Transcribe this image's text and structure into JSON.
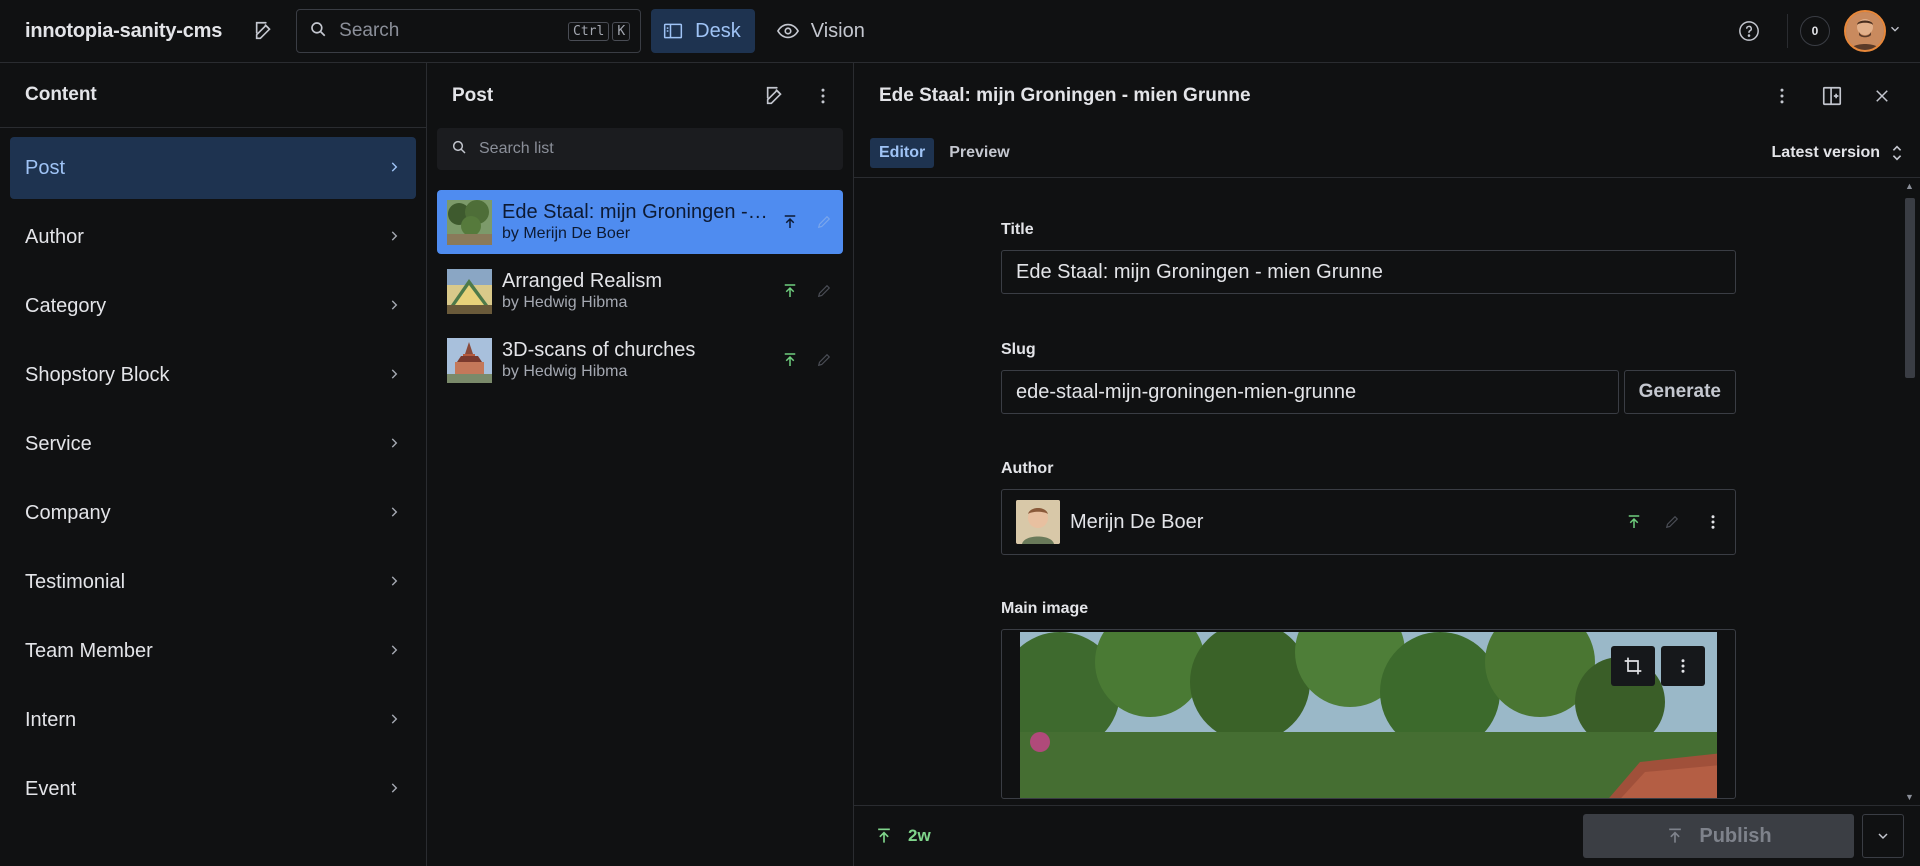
{
  "app": {
    "title": "innotopia-sanity-cms",
    "search_placeholder": "Search",
    "shortcut_keys": [
      "Ctrl",
      "K"
    ],
    "tools": [
      {
        "label": "Desk",
        "icon": "desk-icon",
        "active": true
      },
      {
        "label": "Vision",
        "icon": "eye-icon",
        "active": false
      }
    ],
    "notification_count": "0"
  },
  "content_pane": {
    "title": "Content",
    "items": [
      {
        "label": "Post",
        "active": true
      },
      {
        "label": "Author"
      },
      {
        "label": "Category"
      },
      {
        "label": "Shopstory Block"
      },
      {
        "label": "Service"
      },
      {
        "label": "Company"
      },
      {
        "label": "Testimonial"
      },
      {
        "label": "Team Member"
      },
      {
        "label": "Intern"
      },
      {
        "label": "Event"
      }
    ]
  },
  "post_pane": {
    "title": "Post",
    "search_placeholder": "Search list",
    "documents": [
      {
        "title": "Ede Staal: mijn Groningen - mien Grunne",
        "subtitle": "by Merijn De Boer",
        "active": true,
        "status": "published"
      },
      {
        "title": "Arranged Realism",
        "subtitle": "by Hedwig Hibma",
        "active": false,
        "status": "published"
      },
      {
        "title": "3D-scans of churches",
        "subtitle": "by Hedwig Hibma",
        "active": false,
        "status": "published"
      }
    ]
  },
  "editor": {
    "title": "Ede Staal: mijn Groningen - mien Grunne",
    "tabs": [
      {
        "label": "Editor",
        "active": true
      },
      {
        "label": "Preview",
        "active": false
      }
    ],
    "version_label": "Latest version",
    "fields": {
      "title_label": "Title",
      "title_value": "Ede Staal: mijn Groningen - mien Grunne",
      "slug_label": "Slug",
      "slug_value": "ede-staal-mijn-groningen-mien-grunne",
      "generate_label": "Generate",
      "author_label": "Author",
      "author_value": "Merijn De Boer",
      "main_image_label": "Main image"
    },
    "footer": {
      "status_age": "2w",
      "publish_label": "Publish"
    }
  },
  "colors": {
    "accent": "#4f8cf0",
    "selected_bg": "#1e3350",
    "published_green": "#7fd48b"
  }
}
